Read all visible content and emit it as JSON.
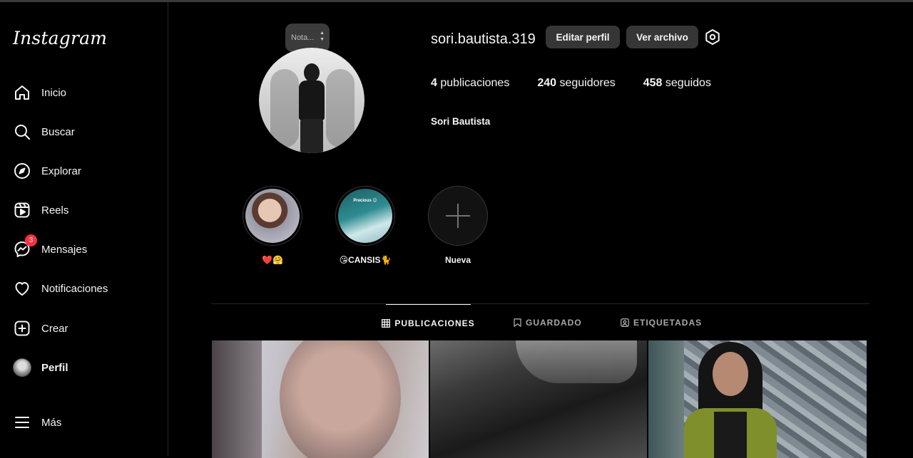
{
  "app": {
    "logo_text": "Instagram"
  },
  "sidebar": {
    "items": [
      {
        "label": "Inicio",
        "icon": "home-icon"
      },
      {
        "label": "Buscar",
        "icon": "search-icon"
      },
      {
        "label": "Explorar",
        "icon": "compass-icon"
      },
      {
        "label": "Reels",
        "icon": "reels-icon"
      },
      {
        "label": "Mensajes",
        "icon": "messenger-icon",
        "badge": "3"
      },
      {
        "label": "Notificaciones",
        "icon": "heart-icon"
      },
      {
        "label": "Crear",
        "icon": "plus-square-icon"
      },
      {
        "label": "Perfil",
        "icon": "avatar",
        "active": true
      },
      {
        "label": "Más",
        "icon": "menu-icon"
      }
    ]
  },
  "profile": {
    "note_placeholder": "Nota...",
    "username": "sori.bautista.319",
    "edit_button": "Editar perfil",
    "archive_button": "Ver archivo",
    "stats": {
      "posts_count": "4",
      "posts_label": "publicaciones",
      "followers_count": "240",
      "followers_label": "seguidores",
      "following_count": "458",
      "following_label": "seguidos"
    },
    "full_name": "Sori Bautista"
  },
  "highlights": [
    {
      "label": "❤️🤗"
    },
    {
      "label": "😘CANSIS🐈",
      "thumb_text": "Precious 😊"
    },
    {
      "label": "Nueva"
    }
  ],
  "tabs": [
    {
      "label": "PUBLICACIONES",
      "icon": "grid-icon",
      "active": true
    },
    {
      "label": "GUARDADO",
      "icon": "bookmark-icon"
    },
    {
      "label": "ETIQUETADAS",
      "icon": "tagged-user-icon"
    }
  ],
  "colors": {
    "background": "#000000",
    "button_bg": "#363636",
    "badge": "#ff3040",
    "muted_text": "#a8a8a8"
  }
}
